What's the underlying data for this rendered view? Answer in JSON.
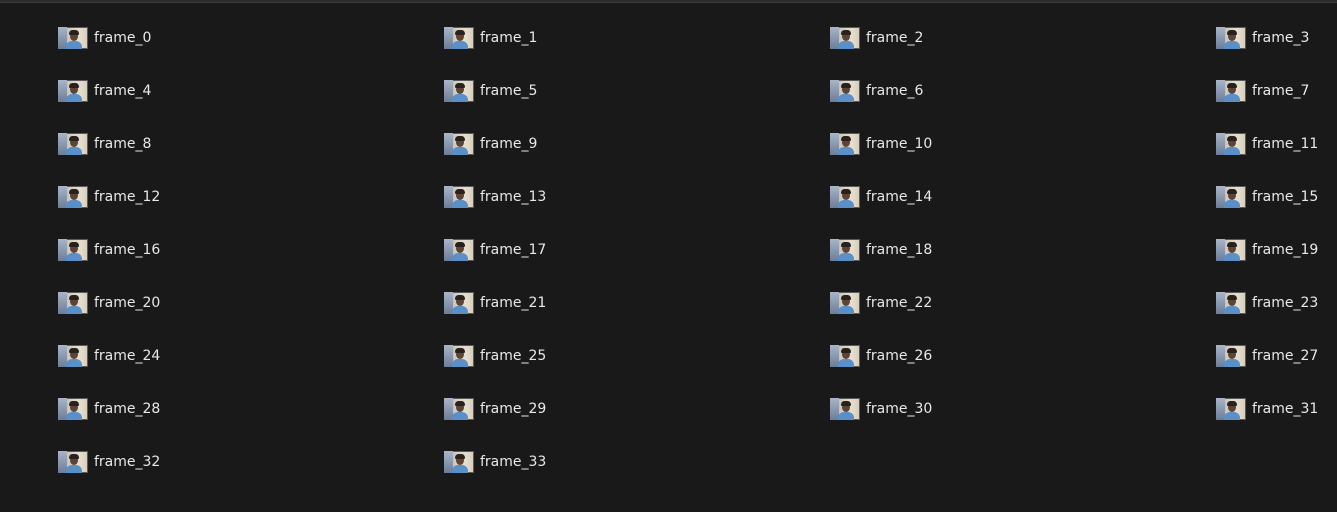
{
  "files": [
    {
      "name": "frame_0"
    },
    {
      "name": "frame_1"
    },
    {
      "name": "frame_2"
    },
    {
      "name": "frame_3"
    },
    {
      "name": "frame_4"
    },
    {
      "name": "frame_5"
    },
    {
      "name": "frame_6"
    },
    {
      "name": "frame_7"
    },
    {
      "name": "frame_8"
    },
    {
      "name": "frame_9"
    },
    {
      "name": "frame_10"
    },
    {
      "name": "frame_11"
    },
    {
      "name": "frame_12"
    },
    {
      "name": "frame_13"
    },
    {
      "name": "frame_14"
    },
    {
      "name": "frame_15"
    },
    {
      "name": "frame_16"
    },
    {
      "name": "frame_17"
    },
    {
      "name": "frame_18"
    },
    {
      "name": "frame_19"
    },
    {
      "name": "frame_20"
    },
    {
      "name": "frame_21"
    },
    {
      "name": "frame_22"
    },
    {
      "name": "frame_23"
    },
    {
      "name": "frame_24"
    },
    {
      "name": "frame_25"
    },
    {
      "name": "frame_26"
    },
    {
      "name": "frame_27"
    },
    {
      "name": "frame_28"
    },
    {
      "name": "frame_29"
    },
    {
      "name": "frame_30"
    },
    {
      "name": "frame_31"
    },
    {
      "name": "frame_32"
    },
    {
      "name": "frame_33"
    }
  ],
  "icons": {
    "thumbnail": "image-thumbnail-icon"
  },
  "colors": {
    "background": "#191919",
    "text": "#e8e8e8"
  }
}
